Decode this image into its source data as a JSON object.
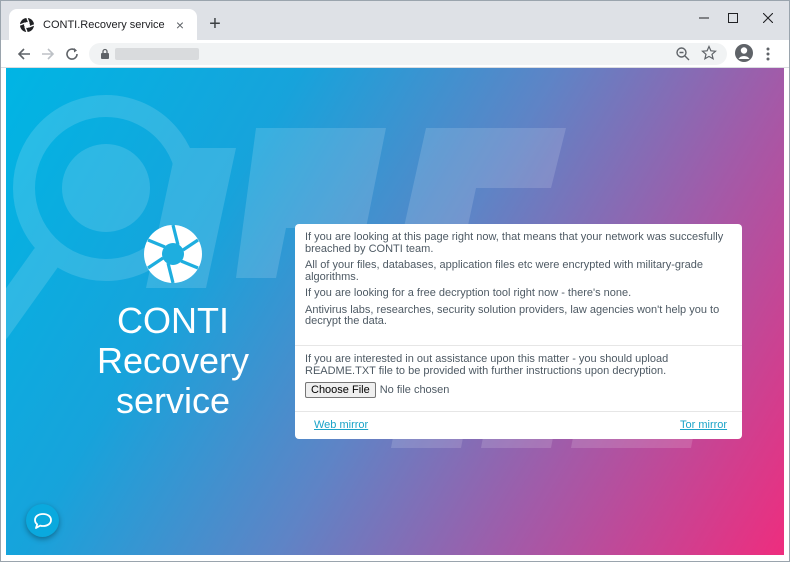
{
  "browser": {
    "tab_title": "CONTI.Recovery service",
    "tab_close": "×",
    "new_tab": "+",
    "menu_glyph": "⋮"
  },
  "brand": {
    "name_line1": "CONTI",
    "name_line2": "Recovery",
    "name_line3": "service"
  },
  "card": {
    "para1": "If you are looking at this page right now, that means that your network was succesfully breached by CONTI team.",
    "para2": "All of your files, databases, application files etc were encrypted with military-grade algorithms.",
    "para3": "If you are looking for a free decryption tool right now - there's none.",
    "para4": "Antivirus labs, researches, security solution providers, law agencies won't help you to decrypt the data.",
    "upload_text": "If you are interested in out assistance upon this matter - you should upload README.TXT file to be provided with further instructions upon decryption.",
    "choose_file_label": "Choose File",
    "no_file_label": "No file chosen",
    "web_mirror_label": "Web mirror",
    "tor_mirror_label": "Tor mirror"
  },
  "colors": {
    "gradient_start": "#00b5e4",
    "gradient_end": "#ee2d7e",
    "link": "#1aa3c8",
    "text": "#4e5a64"
  },
  "icons": {
    "favicon": "aperture-icon",
    "logo": "aperture-icon",
    "chat": "chat-bubble-icon"
  }
}
